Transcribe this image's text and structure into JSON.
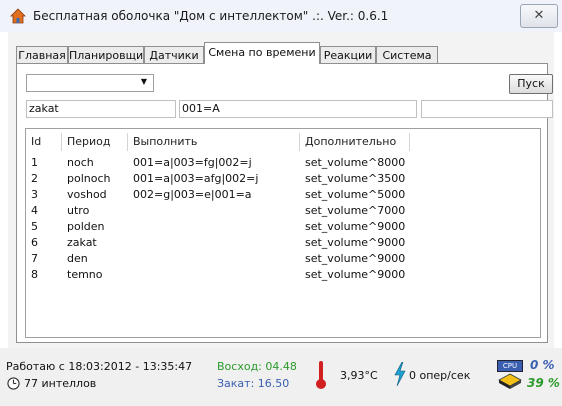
{
  "window": {
    "title": "Бесплатная оболочка \"Дом с интеллектом\" .:. Ver.: 0.6.1",
    "close_label": "✕"
  },
  "tabs": [
    {
      "label": "Главная",
      "active": false
    },
    {
      "label": "Планировщик",
      "active": false
    },
    {
      "label": "Датчики",
      "active": false
    },
    {
      "label": "Смена по времени",
      "active": true
    },
    {
      "label": "Реакции",
      "active": false
    },
    {
      "label": "Система",
      "active": false
    }
  ],
  "controls": {
    "combo_value": "",
    "pusk_label": "Пуск",
    "name_field": "zakat",
    "command_field": "001=A",
    "extra_field": ""
  },
  "list": {
    "headers": [
      "Id",
      "Период",
      "Выполнить",
      "Дополнительно"
    ],
    "rows": [
      {
        "id": "1",
        "period": "noch",
        "exec": "001=a|003=fg|002=j",
        "extra": "set_volume^8000"
      },
      {
        "id": "2",
        "period": "polnoch",
        "exec": "001=a|003=afg|002=j",
        "extra": "set_volume^3500"
      },
      {
        "id": "3",
        "period": "voshod",
        "exec": "002=g|003=e|001=a",
        "extra": "set_volume^5000"
      },
      {
        "id": "4",
        "period": "utro",
        "exec": "",
        "extra": "set_volume^7000"
      },
      {
        "id": "5",
        "period": "polden",
        "exec": "",
        "extra": "set_volume^9000"
      },
      {
        "id": "6",
        "period": "zakat",
        "exec": "",
        "extra": "set_volume^9000"
      },
      {
        "id": "7",
        "period": "den",
        "exec": "",
        "extra": "set_volume^9000"
      },
      {
        "id": "8",
        "period": "temno",
        "exec": "",
        "extra": "set_volume^9000"
      }
    ]
  },
  "status": {
    "uptime": "Работаю с 18:03:2012 - 13:35:47",
    "intellects": "77 интеллов",
    "sunrise": "Восход: 04.48",
    "sunset": "Закат: 16.50",
    "temperature": "3,93°С",
    "ops": "0 опер/сек",
    "cpu_label": "CPU",
    "cpu_percent": "0 %",
    "mem_percent": "39 %"
  },
  "colors": {
    "sun_text": "#2a9a2a",
    "sunset_text": "#3a5fb0",
    "percent_text": "#2a9a2a",
    "cpu_percent_text": "#3a5fb0",
    "thermometer": "#d02020",
    "bolt": "#20a0d0"
  },
  "icons": [
    "house-icon",
    "close-icon",
    "dropdown-arrow-icon",
    "clock-icon",
    "thermometer-icon",
    "lightning-icon",
    "cpu-icon"
  ]
}
